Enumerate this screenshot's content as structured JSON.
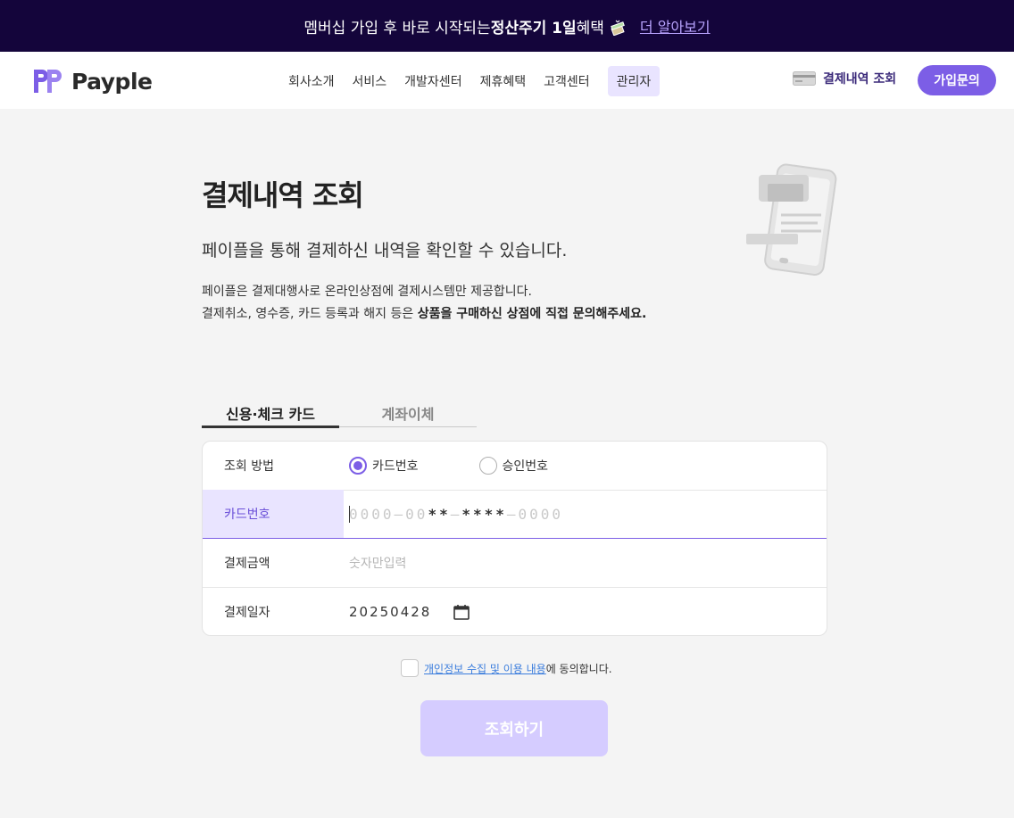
{
  "promo": {
    "text_pre": "멤버십 가입 후 바로 시작되는 ",
    "text_bold": "정산주기 1일",
    "text_post": " 혜택",
    "icon": "gift-icon",
    "more_link": "더 알아보기"
  },
  "header": {
    "logo_text": "Payple",
    "nav": [
      "회사소개",
      "서비스",
      "개발자센터",
      "제휴혜택",
      "고객센터"
    ],
    "nav_active": "관리자",
    "history_link": "결제내역 조회",
    "join_button": "가입문의"
  },
  "main": {
    "title": "결제내역 조회",
    "subtitle": "페이플을 통해 결제하신 내역을 확인할 수 있습니다.",
    "desc_line1": "페이플은 결제대행사로 온라인상점에 결제시스템만 제공합니다.",
    "desc_line2_pre": "결제취소, 영수증, 카드 등록과 해지 등은 ",
    "desc_line2_bold": "상품을 구매하신 상점에 직접 문의해주세요."
  },
  "tabs": [
    {
      "label": "신용·체크 카드",
      "active": true
    },
    {
      "label": "계좌이체",
      "active": false
    }
  ],
  "form": {
    "method_label": "조회 방법",
    "method_options": [
      {
        "label": "카드번호",
        "checked": true
      },
      {
        "label": "승인번호",
        "checked": false
      }
    ],
    "card_label": "카드번호",
    "card_placeholder": {
      "seg1": "0000",
      "sep1": " — ",
      "seg2_plain": "00",
      "seg2_mask": "**",
      "sep2": " — ",
      "seg3_mask": "****",
      "sep3": " — ",
      "seg4": "0000"
    },
    "amount_label": "결제금액",
    "amount_placeholder": "숫자만입력",
    "date_label": "결제일자",
    "date_value": "20250428"
  },
  "agreement": {
    "link_text": "개인정보 수집 및 이용 내용",
    "suffix": "에 동의합니다."
  },
  "submit_label": "조회하기",
  "colors": {
    "promo_bg": "#14053b",
    "accent": "#7c5ee6",
    "accent_light": "#e9e4ff",
    "submit_disabled": "#d5ccff",
    "link": "#3b7ddd"
  }
}
